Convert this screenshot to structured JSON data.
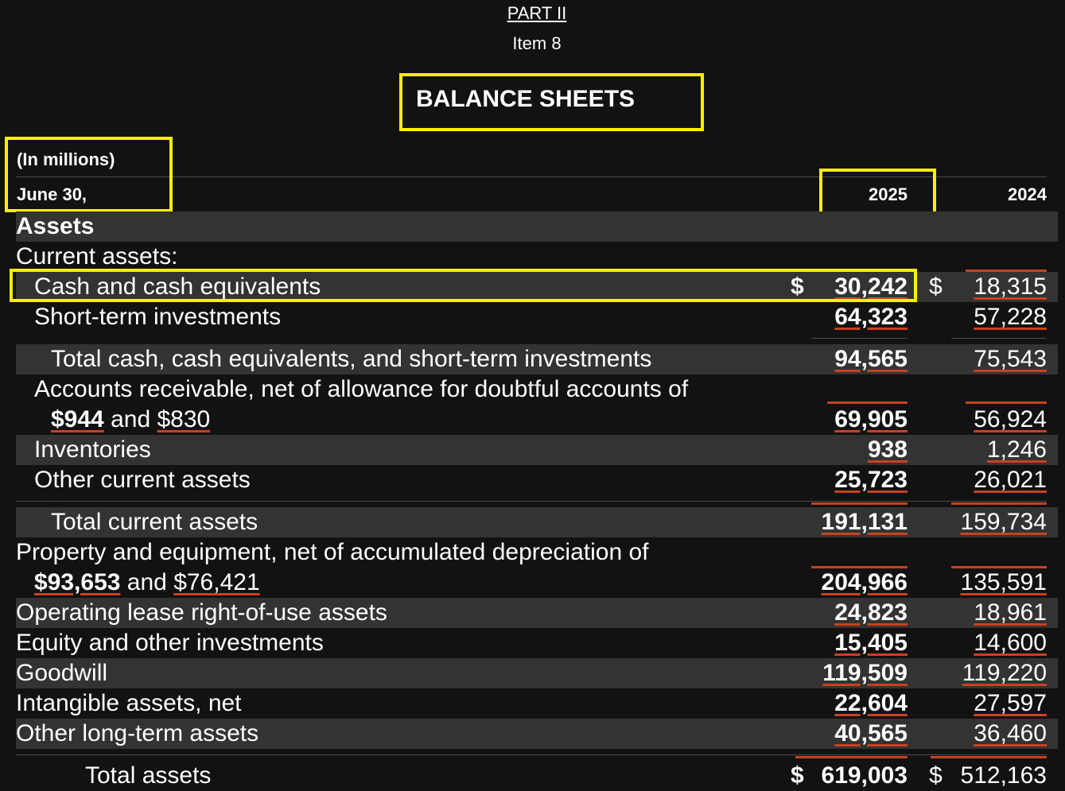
{
  "header": {
    "part": "PART II",
    "item": "Item 8",
    "title": "BALANCE SHEETS",
    "units": "(In millions)",
    "date_label": "June 30,",
    "col_2025": "2025",
    "col_2024": "2024"
  },
  "section": {
    "assets": "Assets",
    "current_assets": "Current assets:"
  },
  "rows": [
    {
      "label": "Cash and cash equivalents",
      "v2025": "30,242",
      "v2024": "18,315",
      "dollar2025": "$",
      "dollar2024": "$"
    },
    {
      "label": "Short-term investments",
      "v2025": "64,323",
      "v2024": "57,228"
    },
    {
      "label": "Total cash, cash equivalents, and short-term investments",
      "v2025": "94,565",
      "v2024": "75,543"
    },
    {
      "label": "Accounts receivable, net of allowance for doubtful accounts of",
      "label_line2_a": "$944",
      "label_line2_b": " and ",
      "label_line2_c": "$830",
      "v2025": "69,905",
      "v2024": "56,924"
    },
    {
      "label": "Inventories",
      "v2025": "938",
      "v2024": "1,246"
    },
    {
      "label": "Other current assets",
      "v2025": "25,723",
      "v2024": "26,021"
    },
    {
      "label": "Total current assets",
      "v2025": "191,131",
      "v2024": "159,734"
    },
    {
      "label": "Property and equipment, net of accumulated depreciation of",
      "label_line2_a": "$93,653",
      "label_line2_b": " and ",
      "label_line2_c": "$76,421",
      "v2025": "204,966",
      "v2024": "135,591"
    },
    {
      "label": "Operating lease right-of-use assets",
      "v2025": "24,823",
      "v2024": "18,961"
    },
    {
      "label": "Equity and other investments",
      "v2025": "15,405",
      "v2024": "14,600"
    },
    {
      "label": "Goodwill",
      "v2025": "119,509",
      "v2024": "119,220"
    },
    {
      "label": "Intangible assets, net",
      "v2025": "22,604",
      "v2024": "27,597"
    },
    {
      "label": "Other long-term assets",
      "v2025": "40,565",
      "v2024": "36,460"
    },
    {
      "label": "Total assets",
      "v2025": "619,003",
      "v2024": "512,163",
      "dollar2025": "$",
      "dollar2024": "$"
    }
  ],
  "colors": {
    "background": "#121212",
    "shade": "#333333",
    "highlight": "#ffef00",
    "spellcheck": "#c9411e"
  }
}
